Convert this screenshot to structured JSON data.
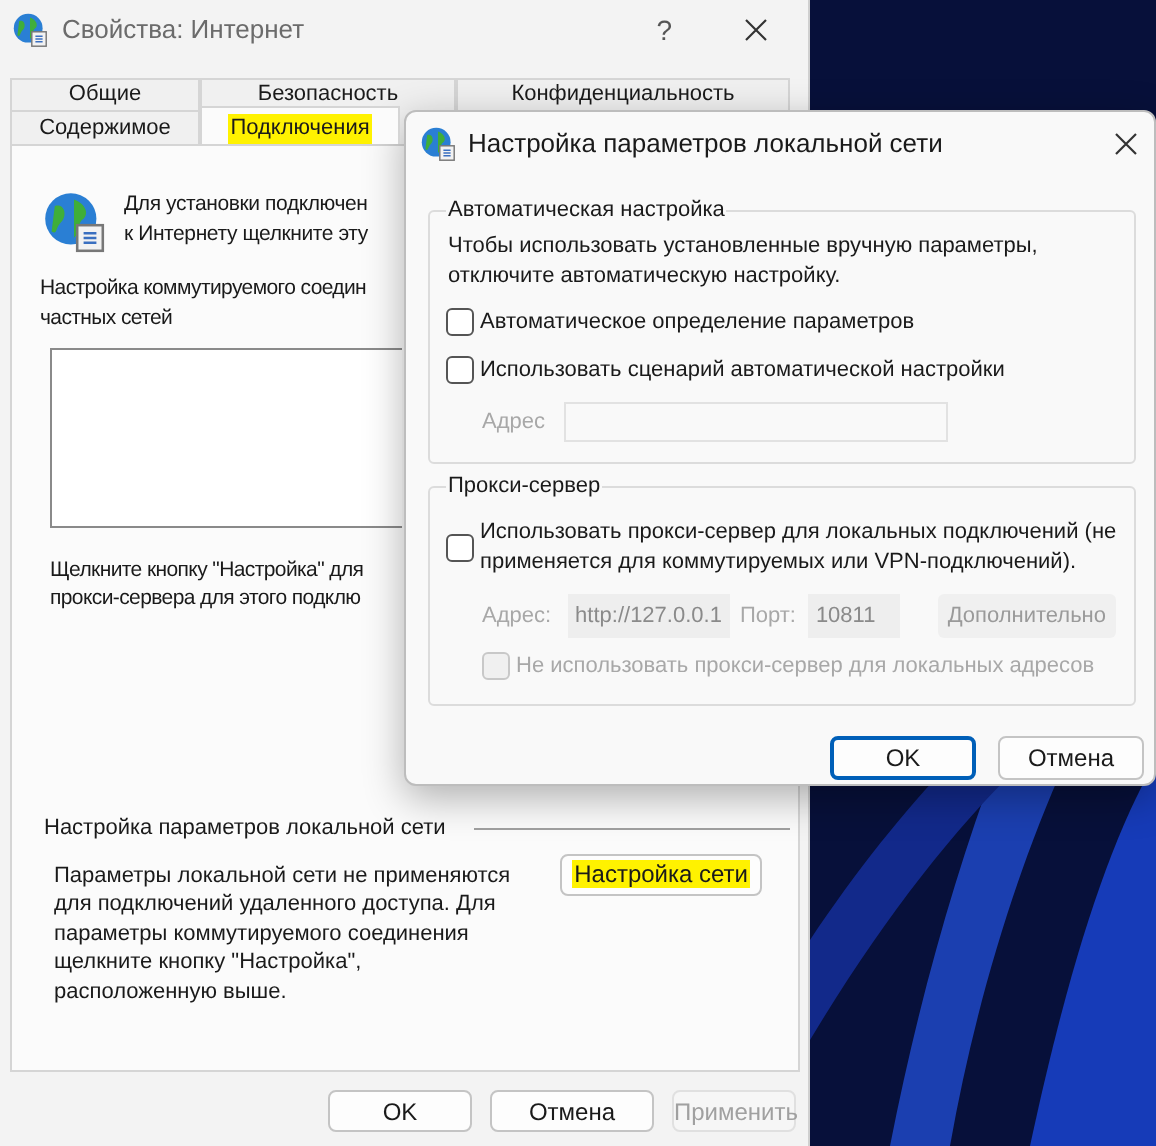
{
  "main_window": {
    "title": "Свойства: Интернет",
    "help_button": "?",
    "tab_rows": [
      [
        {
          "label": "Общие",
          "selected": false,
          "highlighted": false
        },
        {
          "label": "Безопасность",
          "selected": false,
          "highlighted": false
        },
        {
          "label": "Конфиденциальность",
          "selected": false,
          "highlighted": false
        }
      ],
      [
        {
          "label": "Содержимое",
          "selected": false,
          "highlighted": false
        },
        {
          "label": "Подключения",
          "selected": true,
          "highlighted": true
        }
      ]
    ],
    "intro_text": [
      "Для установки подключен",
      "к Интернету щелкните эту"
    ],
    "dialup_label": [
      "Настройка коммутируемого соедин",
      "частных сетей"
    ],
    "proxy_hint": [
      "Щелкните кнопку \"Настройка\" для",
      "прокси-сервера для этого подклю"
    ],
    "lan_section": {
      "title": "Настройка параметров локальной сети",
      "description": [
        "Параметры локальной сети не применяются",
        "для подключений удаленного доступа. Для",
        "параметры коммутируемого соединения",
        "щелкните кнопку \"Настройка\",",
        "расположенную выше."
      ],
      "button": {
        "label": "Настройка сети",
        "highlighted": true
      }
    },
    "buttons": [
      {
        "label": "OK",
        "disabled": false
      },
      {
        "label": "Отмена",
        "disabled": false
      },
      {
        "label": "Применить",
        "disabled": true
      }
    ]
  },
  "lan_dialog": {
    "title": "Настройка параметров локальной сети",
    "auto_config": {
      "legend": "Автоматическая настройка",
      "note": [
        "Чтобы использовать установленные вручную параметры,",
        "отключите автоматическую настройку."
      ],
      "options": [
        {
          "label": "Автоматическое определение параметров",
          "checked": false
        },
        {
          "label": "Использовать сценарий автоматической настройки",
          "checked": false
        }
      ],
      "address": {
        "label": "Адрес",
        "disabled": true
      }
    },
    "proxy": {
      "legend": "Прокси-сервер",
      "option": {
        "label": [
          "Использовать прокси-сервер для локальных подключений (не",
          "применяется для коммутируемых или VPN-подключений)."
        ],
        "checked": false
      },
      "disabled": true,
      "address_label": "Адрес:",
      "address_value": "http://127.0.0.1",
      "port_label": "Порт:",
      "port_value": "10811",
      "advanced_button": "Дополнительно",
      "bypass": {
        "label": "Не использовать прокси-сервер для локальных адресов",
        "checked": false
      }
    },
    "buttons": [
      {
        "label": "OK",
        "default": true
      },
      {
        "label": "Отмена",
        "default": false
      }
    ]
  }
}
